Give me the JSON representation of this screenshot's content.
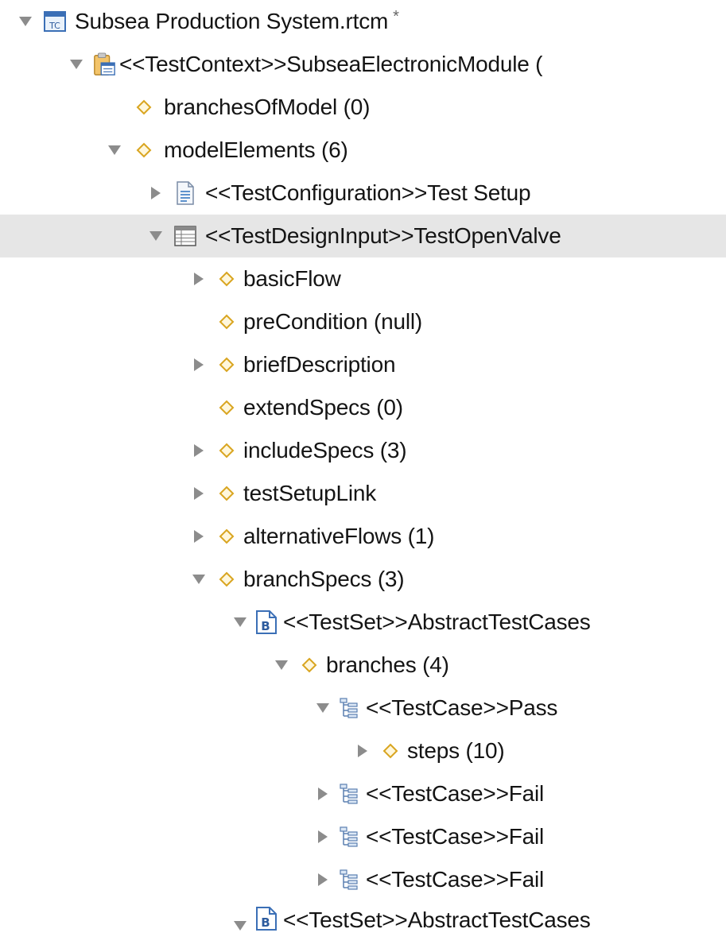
{
  "tree": {
    "root": {
      "label": "Subsea Production System.rtcm",
      "dirty_marker": "*",
      "icon": "rtcm-file-icon"
    },
    "test_context": {
      "label": "<<TestContext>>SubseaElectronicModule (",
      "icon": "test-context-icon"
    },
    "branches_of_model": "branchesOfModel (0)",
    "model_elements": "modelElements (6)",
    "test_configuration": {
      "label": "<<TestConfiguration>>Test Setup",
      "icon": "document-icon"
    },
    "test_design_input": {
      "label": "<<TestDesignInput>>TestOpenValve",
      "icon": "table-icon",
      "selected": true
    },
    "features": {
      "basic_flow": "basicFlow",
      "pre_condition": "preCondition (null)",
      "brief_description": "briefDescription",
      "extend_specs": "extendSpecs (0)",
      "include_specs": "includeSpecs (3)",
      "test_setup_link": "testSetupLink",
      "alternative_flows": "alternativeFlows (1)",
      "branch_specs": "branchSpecs (3)"
    },
    "test_set_1": {
      "label": "<<TestSet>>AbstractTestCases",
      "icon": "test-set-icon",
      "icon_letter": "B"
    },
    "branches": "branches (4)",
    "test_case_pass": "<<TestCase>>Pass",
    "steps": "steps (10)",
    "test_case_fail_1": "<<TestCase>>Fail",
    "test_case_fail_2": "<<TestCase>>Fail",
    "test_case_fail_3": "<<TestCase>>Fail",
    "test_set_2": {
      "label": "<<TestSet>>AbstractTestCases",
      "icon": "test-set-icon",
      "icon_letter": "B"
    }
  },
  "colors": {
    "selection_background": "#e6e6e6",
    "twisty_gray": "#8c8c8c",
    "feature_diamond": "#d9a520",
    "icon_blue": "#3b6fb6",
    "text": "#141414"
  }
}
